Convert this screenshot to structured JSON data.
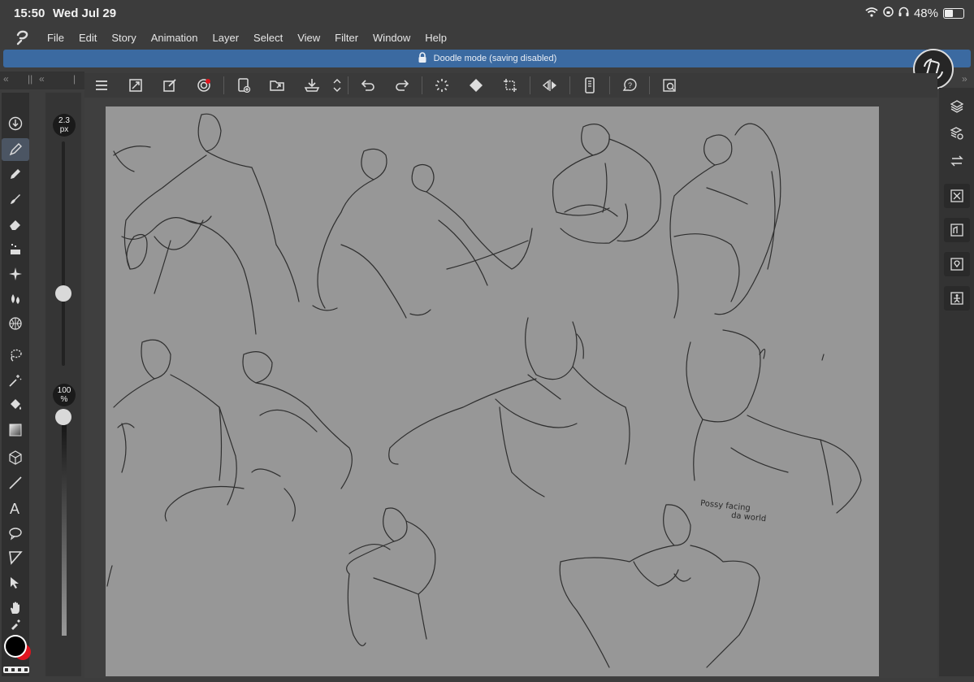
{
  "status": {
    "time": "15:50",
    "date": "Wed Jul 29",
    "battery": "48%"
  },
  "menu": [
    "File",
    "Edit",
    "Story",
    "Animation",
    "Layer",
    "Select",
    "View",
    "Filter",
    "Window",
    "Help"
  ],
  "banner": {
    "text": "Doodle mode (saving disabled)"
  },
  "brush": {
    "size_value": "2.3",
    "size_unit": "px",
    "opacity_value": "100",
    "opacity_unit": "%",
    "size_level": 0.31,
    "opacity_level": 1.0
  },
  "canvas": {
    "handwritten_note_line1": "Possy facing",
    "handwritten_note_line2": "da world"
  },
  "colors": {
    "accent": "#3b6aa1",
    "main_color": "#000000",
    "sub_color": "#e0141e",
    "paper": "#979797"
  },
  "toolbar_icons": [
    "menu-icon",
    "fit-icon",
    "transform-icon",
    "record-icon",
    "new-icon",
    "open-icon",
    "save-icon",
    "scroll-icon",
    "undo-icon",
    "redo-icon",
    "loading-icon",
    "fill-icon",
    "crop-icon",
    "flip-icon",
    "device-icon",
    "help-icon",
    "settings-icon"
  ]
}
